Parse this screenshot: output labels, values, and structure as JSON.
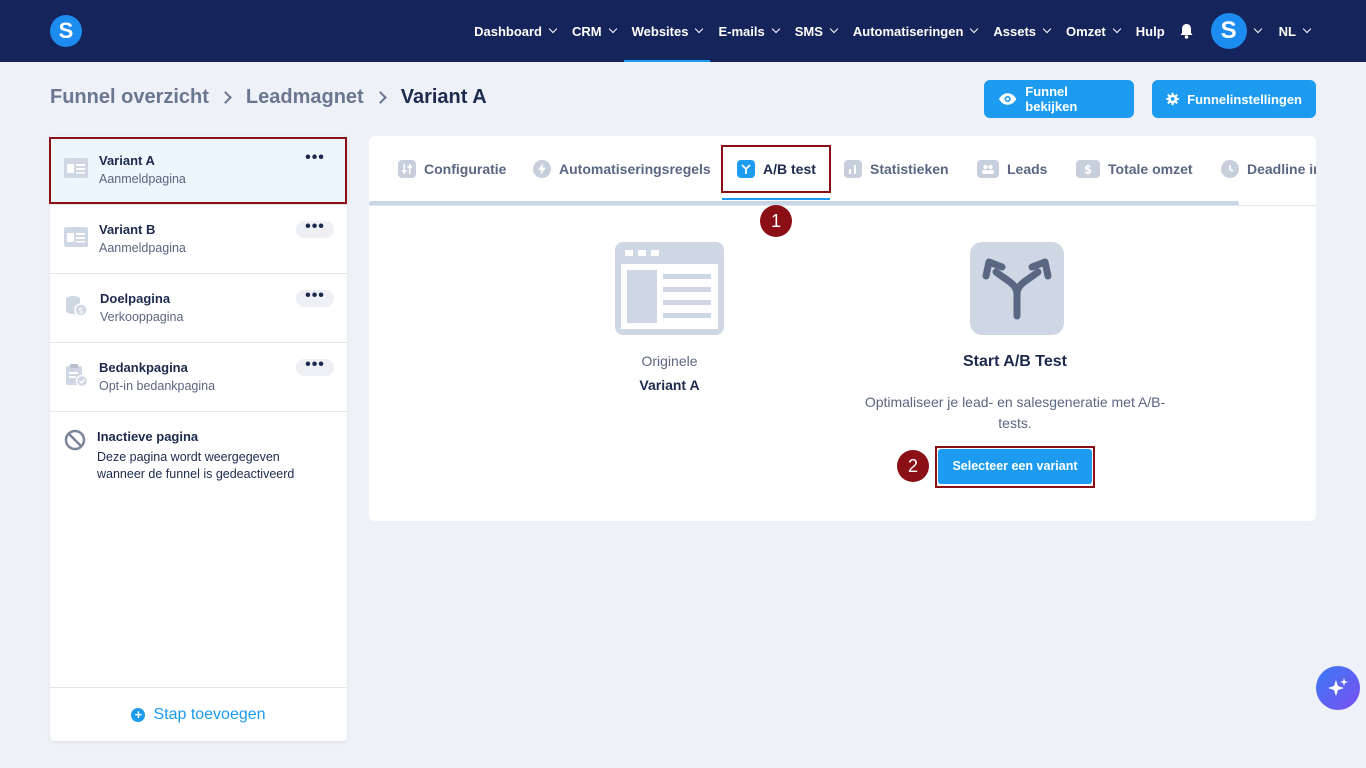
{
  "nav": {
    "items": [
      {
        "label": "Dashboard",
        "dropdown": true
      },
      {
        "label": "CRM",
        "dropdown": true
      },
      {
        "label": "Websites",
        "dropdown": true,
        "active": true
      },
      {
        "label": "E-mails",
        "dropdown": true
      },
      {
        "label": "SMS",
        "dropdown": true
      },
      {
        "label": "Automatiseringen",
        "dropdown": true
      },
      {
        "label": "Assets",
        "dropdown": true
      },
      {
        "label": "Omzet",
        "dropdown": true
      },
      {
        "label": "Hulp",
        "dropdown": false
      }
    ],
    "logo_letter": "S",
    "avatar_letter": "S",
    "language": "NL"
  },
  "breadcrumb": {
    "items": [
      "Funnel overzicht",
      "Leadmagnet",
      "Variant A"
    ]
  },
  "actions": {
    "view_funnel": "Funnel bekijken",
    "funnel_settings": "Funnelinstellingen"
  },
  "sidebar": {
    "steps": [
      {
        "title": "Variant A",
        "subtitle": "Aanmeldpagina",
        "icon": "page-form-icon",
        "selected": true
      },
      {
        "title": "Variant B",
        "subtitle": "Aanmeldpagina",
        "icon": "page-form-icon"
      },
      {
        "title": "Doelpagina",
        "subtitle": "Verkooppagina",
        "icon": "coins-icon"
      },
      {
        "title": "Bedankpagina",
        "subtitle": "Opt-in bedankpagina",
        "icon": "clipboard-check-icon"
      }
    ],
    "more_label": "•••",
    "inactive": {
      "title": "Inactieve pagina",
      "description": "Deze pagina wordt weergegeven wanneer de funnel is gedeactiveerd"
    },
    "add_step": "Stap toevoegen"
  },
  "tabs": [
    {
      "label": "Configuratie",
      "icon": "sliders-icon"
    },
    {
      "label": "Automatiseringsregels",
      "icon": "bolt-icon"
    },
    {
      "label": "A/B test",
      "icon": "split-icon",
      "active": true
    },
    {
      "label": "Statistieken",
      "icon": "bar-chart-icon"
    },
    {
      "label": "Leads",
      "icon": "users-icon"
    },
    {
      "label": "Totale omzet",
      "icon": "dollar-icon"
    },
    {
      "label": "Deadline in",
      "icon": "clock-icon"
    }
  ],
  "ab_test": {
    "original_label": "Originele",
    "original_name": "Variant A",
    "title": "Start A/B Test",
    "description": "Optimaliseer je lead- en salesgeneratie met A/B-tests.",
    "select_button": "Selecteer een variant"
  },
  "annotations": [
    "1",
    "2"
  ],
  "colors": {
    "nav_bg": "#15245a",
    "accent": "#1c9bf0",
    "highlight": "#8b1016",
    "page_bg": "#eef1f7"
  }
}
